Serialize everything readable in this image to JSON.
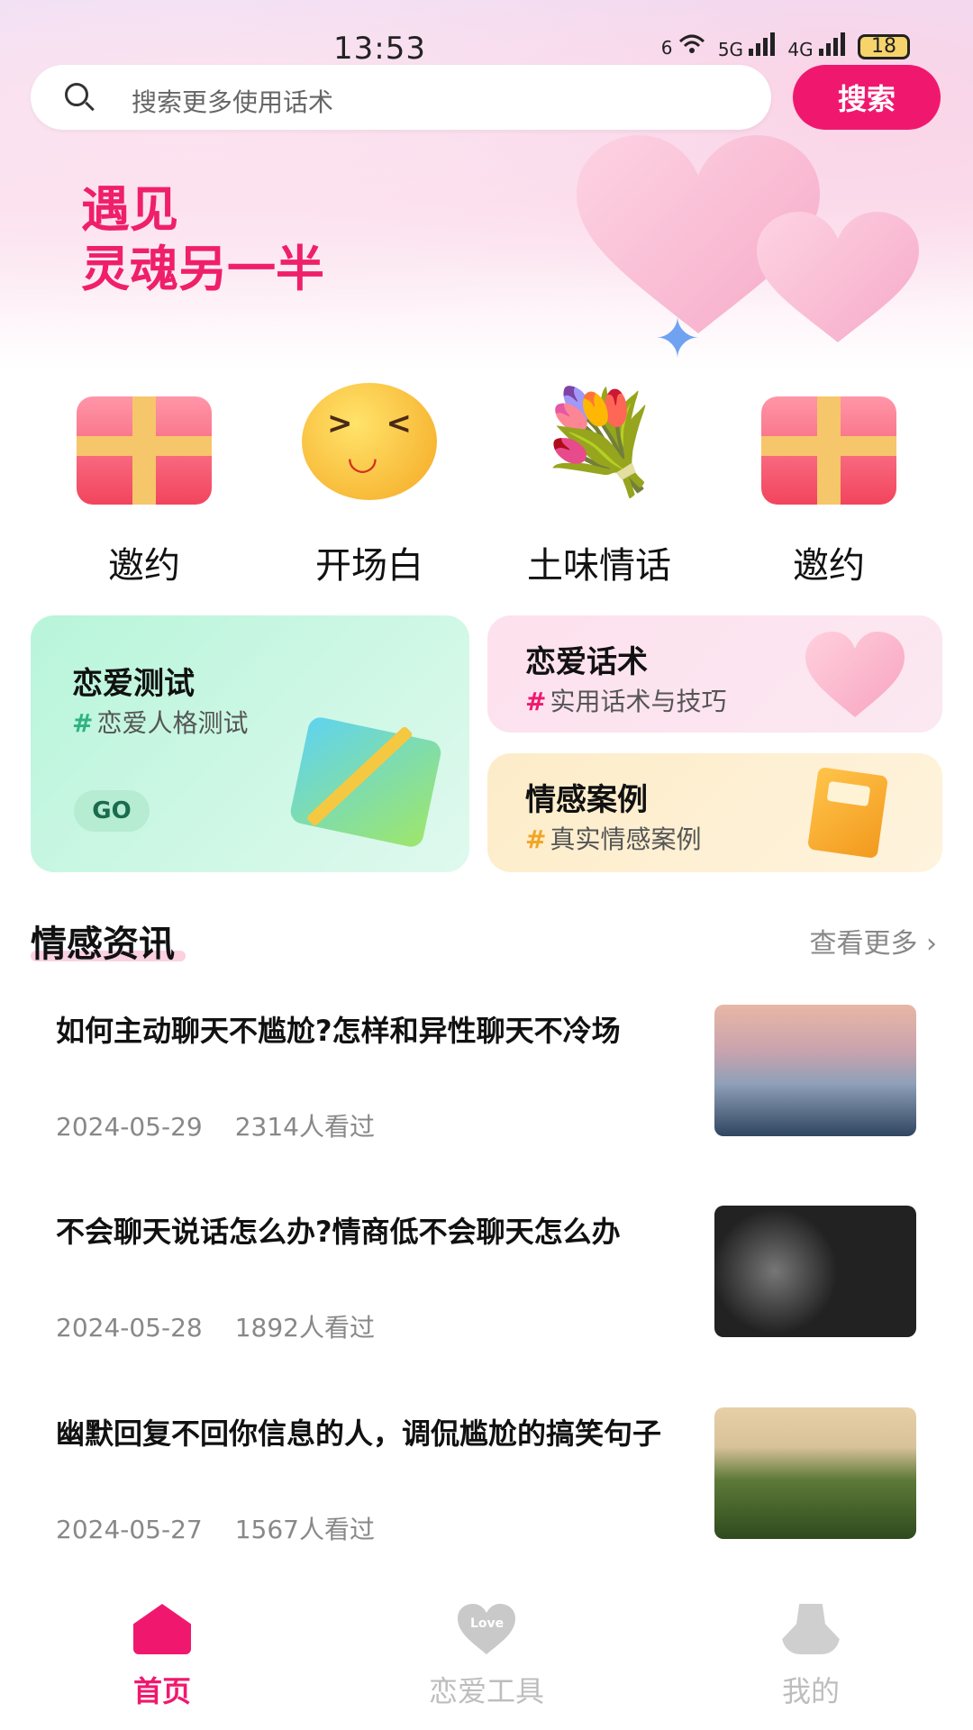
{
  "status_bar": {
    "time": "13:53",
    "net1": "6",
    "net2": "5G",
    "net3": "4G",
    "battery": "18"
  },
  "search": {
    "placeholder": "搜索更多使用话术",
    "button_label": "搜索"
  },
  "banner": {
    "line1": "遇见",
    "line2": "灵魂另一半"
  },
  "categories": [
    {
      "label": "邀约",
      "icon": "gift-icon"
    },
    {
      "label": "开场白",
      "icon": "smiley-icon"
    },
    {
      "label": "土味情话",
      "icon": "bouquet-icon"
    },
    {
      "label": "邀约",
      "icon": "gift-icon"
    }
  ],
  "cards": {
    "test": {
      "title": "恋爱测试",
      "hash": "#",
      "subtitle": "恋爱人格测试",
      "button": "GO",
      "accent": "#2fb383"
    },
    "talk": {
      "title": "恋爱话术",
      "hash": "#",
      "subtitle": "实用话术与技巧",
      "accent": "#f0186e"
    },
    "case": {
      "title": "情感案例",
      "hash": "#",
      "subtitle": "真实情感案例",
      "accent": "#f2a526"
    }
  },
  "news": {
    "heading": "情感资讯",
    "more": "查看更多 ›",
    "items": [
      {
        "title": "如何主动聊天不尴尬?怎样和异性聊天不冷场",
        "date": "2024-05-29",
        "views": "2314人看过"
      },
      {
        "title": "不会聊天说话怎么办?情商低不会聊天怎么办",
        "date": "2024-05-28",
        "views": "1892人看过"
      },
      {
        "title": "幽默回复不回你信息的人，调侃尴尬的搞笑句子",
        "date": "2024-05-27",
        "views": "1567人看过"
      }
    ]
  },
  "tabbar": {
    "items": [
      {
        "label": "首页",
        "active": true
      },
      {
        "label": "恋爱工具",
        "active": false,
        "icon_text": "Love"
      },
      {
        "label": "我的",
        "active": false
      }
    ]
  },
  "colors": {
    "brand": "#f0186e"
  }
}
